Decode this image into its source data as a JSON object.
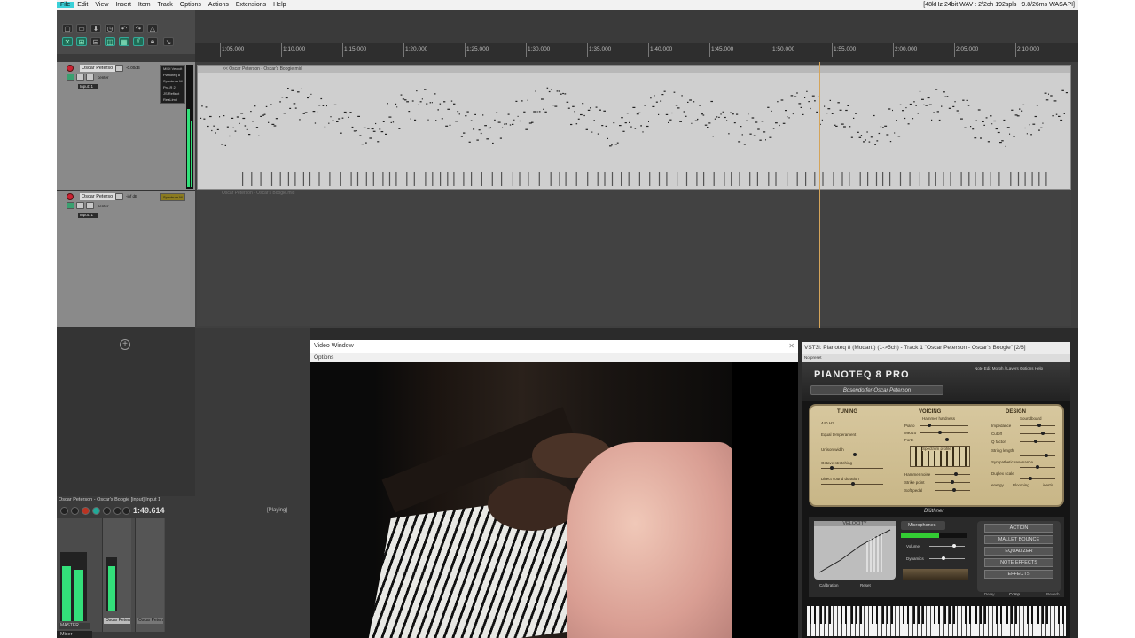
{
  "menu": {
    "items": [
      "File",
      "Edit",
      "View",
      "Insert",
      "Item",
      "Track",
      "Options",
      "Actions",
      "Extensions",
      "Help"
    ],
    "status": "[48kHz 24bit WAV : 2/2ch 192spls ~9.8/26ms WASAPI]"
  },
  "ruler": {
    "ticks": [
      "1:05.000",
      "1:10.000",
      "1:15.000",
      "1:20.000",
      "1:25.000",
      "1:30.000",
      "1:35.000",
      "1:40.000",
      "1:45.000",
      "1:50.000",
      "1:55.000",
      "2:00.000",
      "2:05.000",
      "2:10.000"
    ]
  },
  "tracks": [
    {
      "name": "Oscar Peterso",
      "volume": "-0.00dB",
      "pan": "center",
      "input": "Input: 1",
      "fx": [
        "MIDI Velocit",
        "Pianoteq 8",
        "Spectrum M",
        "Pro-R 2",
        "JS:Reflect",
        "ReaLimit"
      ],
      "item_label": "<< Oscar Peterson - Oscar's Boogie.mid"
    },
    {
      "name": "Oscar Peterso",
      "volume": "-inf dB",
      "pan": "center",
      "input": "Input: 1",
      "fx": [
        "Spectrum M"
      ],
      "item_label": "Oscar Peterson - Oscar's Boogie.mid"
    }
  ],
  "transport": {
    "title": "Oscar Peterson - Oscar's Boogie [input] Input 1",
    "time": "1:49.614",
    "status": "[Playing]"
  },
  "mixer": {
    "master_label": "MASTER",
    "strip1": "Oscar Petersc",
    "strip2": "Oscar Peterso",
    "tab": "Mixer"
  },
  "video": {
    "title": "Video Window",
    "options": "Options"
  },
  "vst": {
    "title": "VST3i: Pianoteq 8 (Modartt) (1->5ch) - Track 1 \"Oscar Peterson - Oscar's Boogie\" [2/6]",
    "bar": "No preset",
    "logo": "PIANOTEQ 8 PRO",
    "nav": "Note Edit   Morph / Layers      Options   Help",
    "preset": "Bosendorfer-Oscar Peterson",
    "tuning": {
      "title": "TUNING",
      "hz": "440 Hz",
      "temperament": "Equal temperament",
      "unison": "Unison width",
      "octave": "Octave stretching",
      "direct": "Direct sound duration"
    },
    "voicing": {
      "title": "VOICING",
      "hammer": "Hammer hardness",
      "piano": "Piano",
      "mezzo": "Mezzo",
      "forte": "Forte",
      "spectrum": "Spectrum profile",
      "noise": "Hammer noise",
      "strike": "Strike point",
      "soft": "Soft pedal"
    },
    "design": {
      "title": "DESIGN",
      "soundboard": "Soundboard",
      "impedance": "Impedance",
      "cutoff": "Cutoff",
      "q": "Q factor",
      "string": "String length",
      "sympathetic": "Sympathetic resonance",
      "duplex": "Duplex scale",
      "blooming": "Blooming",
      "energy": "energy",
      "inertia": "inertia"
    },
    "velocity": "VELOCITY",
    "mic": "Microphones",
    "volume": "Volume",
    "dynamics": "Dynamics",
    "calibration": "Calibration",
    "reset": "Reset",
    "buttons": [
      "ACTION",
      "MALLET BOUNCE",
      "EQUALIZER",
      "NOTE EFFECTS",
      "EFFECTS"
    ],
    "footer": [
      "Delay",
      "Comp",
      "Reverb"
    ],
    "brand": "Blüthner"
  }
}
